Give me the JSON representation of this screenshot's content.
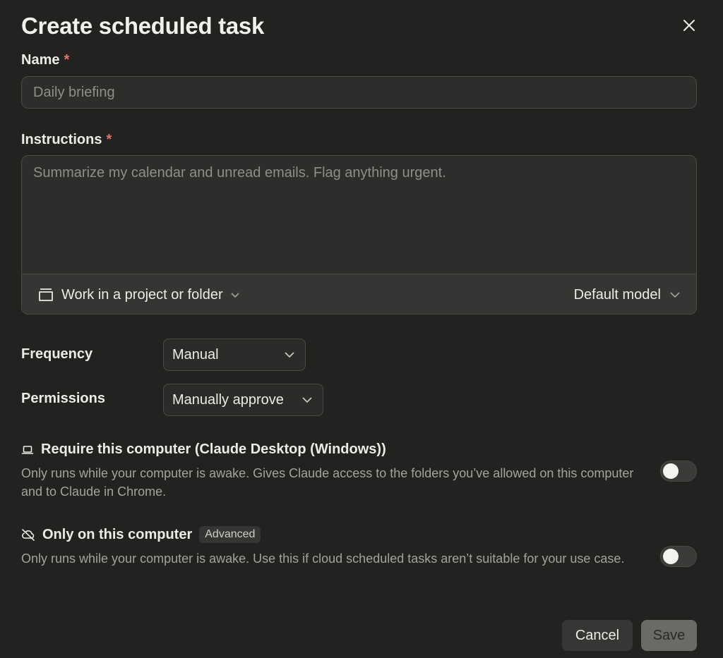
{
  "dialog": {
    "title": "Create scheduled task",
    "close_icon": "close-icon"
  },
  "name_field": {
    "label": "Name",
    "required_mark": "*",
    "value": "",
    "placeholder": "Daily briefing"
  },
  "instructions_field": {
    "label": "Instructions",
    "required_mark": "*",
    "value": "",
    "placeholder": "Summarize my calendar and unread emails. Flag anything urgent.",
    "project_button": {
      "icon": "folder-icon",
      "label": "Work in a project or folder"
    },
    "model_button": {
      "label": "Default model"
    }
  },
  "frequency": {
    "label": "Frequency",
    "selected": "Manual"
  },
  "permissions": {
    "label": "Permissions",
    "selected": "Manually approve"
  },
  "require_computer": {
    "icon": "laptop-icon",
    "title": "Require this computer (Claude Desktop (Windows))",
    "description": "Only runs while your computer is awake. Gives Claude access to the folders you’ve allowed on this computer and to Claude in Chrome.",
    "enabled": false
  },
  "only_this_computer": {
    "icon": "cloud-off-icon",
    "title": "Only on this computer",
    "badge": "Advanced",
    "description": "Only runs while your computer is awake. Use this if cloud scheduled tasks aren’t suitable for your use case.",
    "enabled": false
  },
  "footer": {
    "cancel_label": "Cancel",
    "save_label": "Save"
  },
  "colors": {
    "background": "#222221",
    "required": "#e0736c",
    "input_bg": "#2d2d2b",
    "border": "#4a4946",
    "save_bg": "#6b6a66"
  }
}
